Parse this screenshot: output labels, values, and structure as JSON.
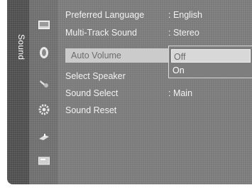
{
  "sidebar": {
    "title": "Sound",
    "icons": [
      "picture-icon",
      "sound-icon",
      "channel-icon",
      "setup-icon",
      "input-icon",
      "application-icon",
      "support-icon"
    ]
  },
  "menu": {
    "items": [
      {
        "label": "Preferred Language",
        "value": ": English"
      },
      {
        "label": "Multi-Track Sound",
        "value": ": Stereo"
      },
      {
        "label": "Auto Volume",
        "value": ""
      },
      {
        "label": "Select Speaker",
        "value": ""
      },
      {
        "label": "Sound Select",
        "value": ": Main"
      },
      {
        "label": "Sound Reset",
        "value": ""
      }
    ]
  },
  "dropdown": {
    "options": [
      "Off",
      "On"
    ],
    "selected": "Off"
  },
  "colors": {
    "sidebar_tab": "#4e4e4e",
    "icon_column": "#6e6e6e",
    "menu_background": "#7a7a7a",
    "highlight": "#b8b8b8",
    "text": "#f2f2f2"
  }
}
